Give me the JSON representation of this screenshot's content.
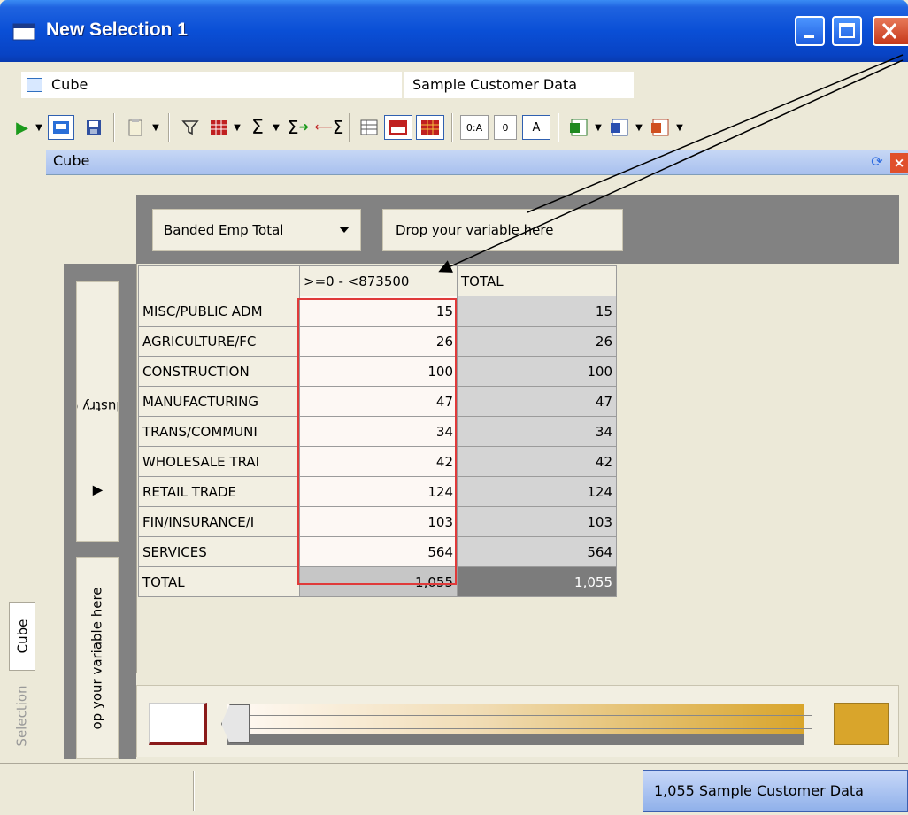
{
  "window": {
    "title": "New Selection 1"
  },
  "info": {
    "cube_label": "Cube",
    "data_source": "Sample Customer Data"
  },
  "pane": {
    "title": "Cube"
  },
  "side_tabs": {
    "cube": "Cube",
    "selection": "Selection"
  },
  "columns": {
    "variable": "Banded Emp Total",
    "drop_hint": "Drop your variable here"
  },
  "rows": {
    "variable": "Major Industry Category",
    "drop_hint": "op your variable here"
  },
  "grid": {
    "headers": [
      ">=0 - <873500",
      "TOTAL"
    ],
    "rows": [
      {
        "label": "MISC/PUBLIC ADM",
        "band": "15",
        "total": "15"
      },
      {
        "label": "AGRICULTURE/FC",
        "band": "26",
        "total": "26"
      },
      {
        "label": "CONSTRUCTION",
        "band": "100",
        "total": "100"
      },
      {
        "label": "MANUFACTURING",
        "band": "47",
        "total": "47"
      },
      {
        "label": "TRANS/COMMUNI",
        "band": "34",
        "total": "34"
      },
      {
        "label": "WHOLESALE TRAI",
        "band": "42",
        "total": "42"
      },
      {
        "label": "RETAIL TRADE",
        "band": "124",
        "total": "124"
      },
      {
        "label": "FIN/INSURANCE/I",
        "band": "103",
        "total": "103"
      },
      {
        "label": "SERVICES",
        "band": "564",
        "total": "564"
      }
    ],
    "total_row": {
      "label": "TOTAL",
      "band": "1,055",
      "total": "1,055"
    }
  },
  "status": {
    "message": "1,055 Sample Customer Data"
  },
  "colors": {
    "title_blue": "#0a4fd6",
    "highlight_red": "#e03a3a",
    "gradient_high": "#d9a52b"
  }
}
